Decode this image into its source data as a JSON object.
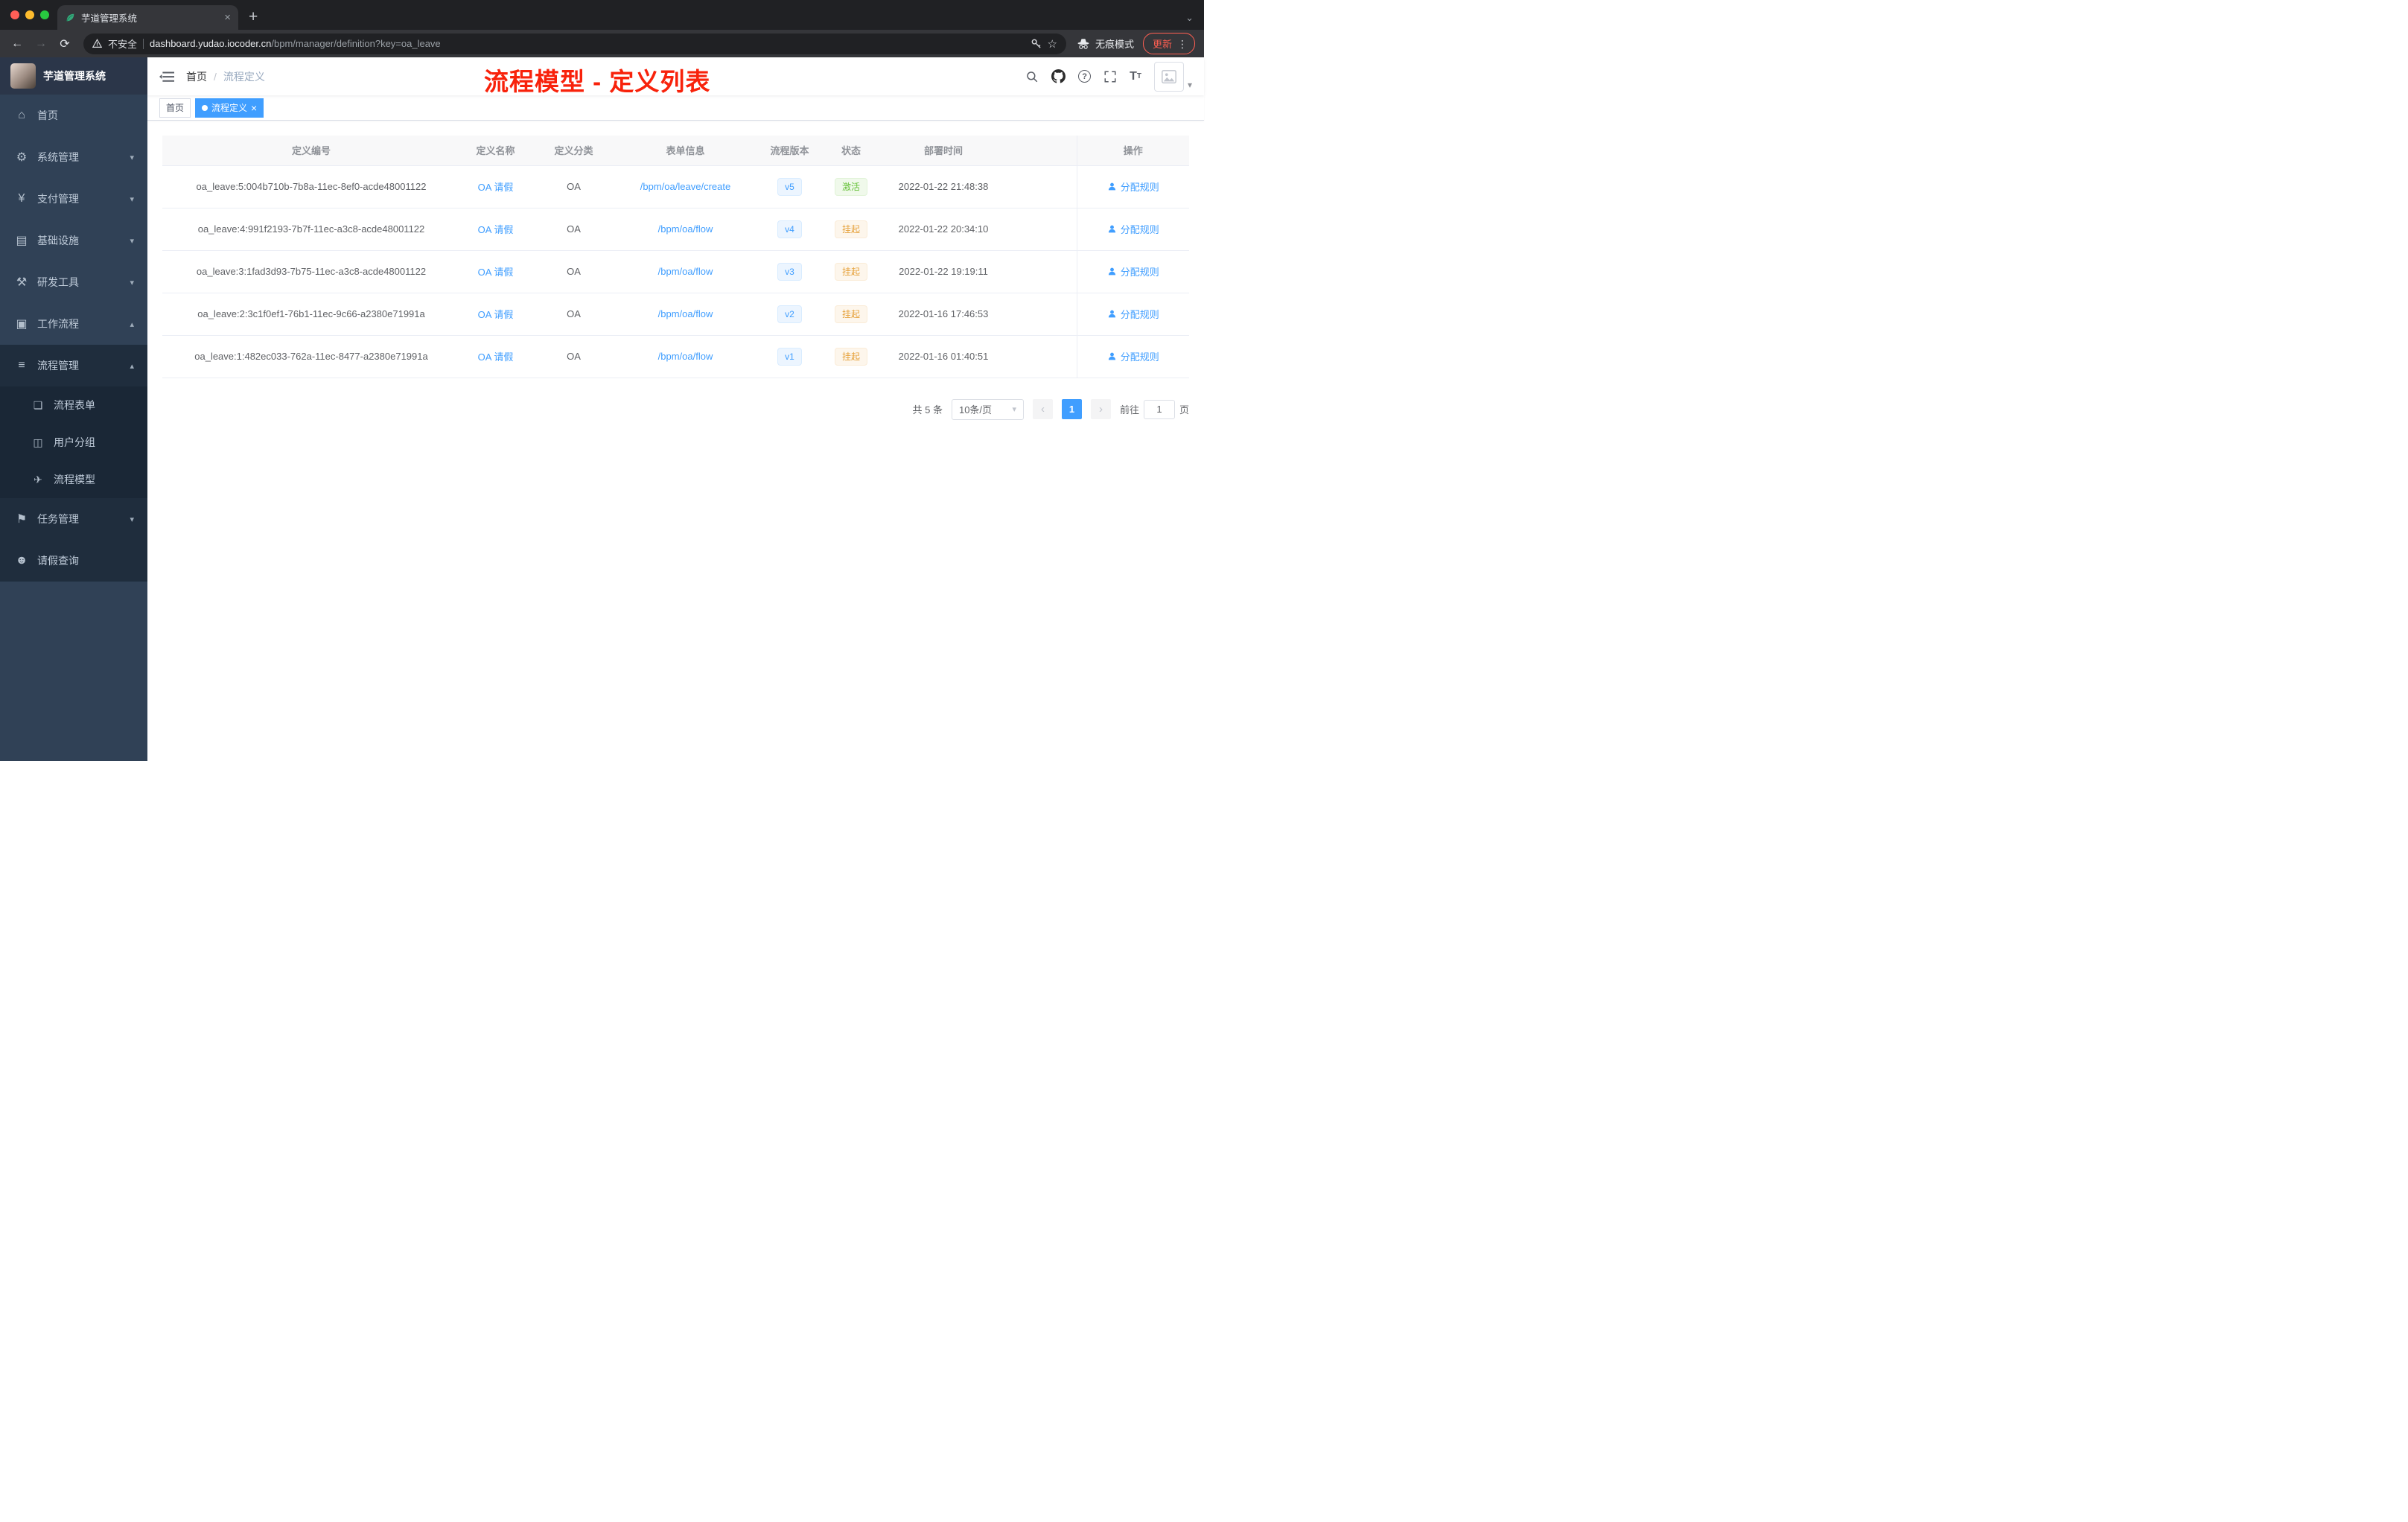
{
  "colors": {
    "primary": "#409eff",
    "success": "#67c23a",
    "warning": "#e6a23c",
    "annotation": "#f8220b",
    "sidebar_bg": "#304156",
    "submenu_bg": "#1f2d3d",
    "update": "#ff5f52",
    "traffic_lights": [
      "#ff5f57",
      "#febc2e",
      "#28c840"
    ]
  },
  "browser": {
    "tab_title": "芋道管理系统",
    "security_label": "不安全",
    "url_domain": "dashboard.yudao.iocoder.cn",
    "url_path": "/bpm/manager/definition?key=oa_leave",
    "incognito_label": "无痕模式",
    "update_label": "更新"
  },
  "icons": {
    "home": "⌂",
    "system": "⚙",
    "pay": "¥",
    "infra": "▤",
    "tools": "⚒",
    "workflow": "▣",
    "process_mgmt": "≡",
    "form": "❏",
    "user_group": "◫",
    "process_model": "✈",
    "task": "⚑",
    "person": "☻",
    "chevron_down": "▾",
    "chevron_up": "▴",
    "close": "×",
    "question": "?",
    "back": "←",
    "forward": "→",
    "reload": "⟳",
    "star": "☆",
    "menu_dots": "⋮",
    "tab_search": "⌄",
    "select_caret": "▾",
    "prev": "‹",
    "next": "›",
    "new_tab": "+",
    "font_size_big": "T",
    "font_size_small": "T"
  },
  "sidebar": {
    "logo_title": "芋道管理系统",
    "menu": [
      {
        "label": "首页"
      },
      {
        "label": "系统管理"
      },
      {
        "label": "支付管理"
      },
      {
        "label": "基础设施"
      },
      {
        "label": "研发工具"
      },
      {
        "label": "工作流程"
      }
    ],
    "process_management": "流程管理",
    "process_children": [
      {
        "label": "流程表单"
      },
      {
        "label": "用户分组"
      },
      {
        "label": "流程模型"
      }
    ],
    "task_management": "任务管理",
    "leave_query": "请假查询"
  },
  "header": {
    "breadcrumb_home": "首页",
    "breadcrumb_sep": "/",
    "breadcrumb_current": "流程定义",
    "annotation": "流程模型 - 定义列表"
  },
  "tags": [
    {
      "label": "首页"
    },
    {
      "label": "流程定义"
    }
  ],
  "table": {
    "columns": [
      "定义编号",
      "定义名称",
      "定义分类",
      "表单信息",
      "流程版本",
      "状态",
      "部署时间",
      "操作"
    ],
    "rows": [
      {
        "id": "oa_leave:5:004b710b-7b8a-11ec-8ef0-acde48001122",
        "name": "OA 请假",
        "category": "OA",
        "form": "/bpm/oa/leave/create",
        "version": "v5",
        "status": "激活",
        "status_type": "success",
        "deploy_time": "2022-01-22 21:48:38",
        "action": "分配规则"
      },
      {
        "id": "oa_leave:4:991f2193-7b7f-11ec-a3c8-acde48001122",
        "name": "OA 请假",
        "category": "OA",
        "form": "/bpm/oa/flow",
        "version": "v4",
        "status": "挂起",
        "status_type": "warning",
        "deploy_time": "2022-01-22 20:34:10",
        "action": "分配规则"
      },
      {
        "id": "oa_leave:3:1fad3d93-7b75-11ec-a3c8-acde48001122",
        "name": "OA 请假",
        "category": "OA",
        "form": "/bpm/oa/flow",
        "version": "v3",
        "status": "挂起",
        "status_type": "warning",
        "deploy_time": "2022-01-22 19:19:11",
        "action": "分配规则"
      },
      {
        "id": "oa_leave:2:3c1f0ef1-76b1-11ec-9c66-a2380e71991a",
        "name": "OA 请假",
        "category": "OA",
        "form": "/bpm/oa/flow",
        "version": "v2",
        "status": "挂起",
        "status_type": "warning",
        "deploy_time": "2022-01-16 17:46:53",
        "action": "分配规则"
      },
      {
        "id": "oa_leave:1:482ec033-762a-11ec-8477-a2380e71991a",
        "name": "OA 请假",
        "category": "OA",
        "form": "/bpm/oa/flow",
        "version": "v1",
        "status": "挂起",
        "status_type": "warning",
        "deploy_time": "2022-01-16 01:40:51",
        "action": "分配规则"
      }
    ]
  },
  "pagination": {
    "total": "共 5 条",
    "page_size": "10条/页",
    "page": "1",
    "goto_label": "前往",
    "goto_value": "1",
    "goto_unit": "页"
  }
}
